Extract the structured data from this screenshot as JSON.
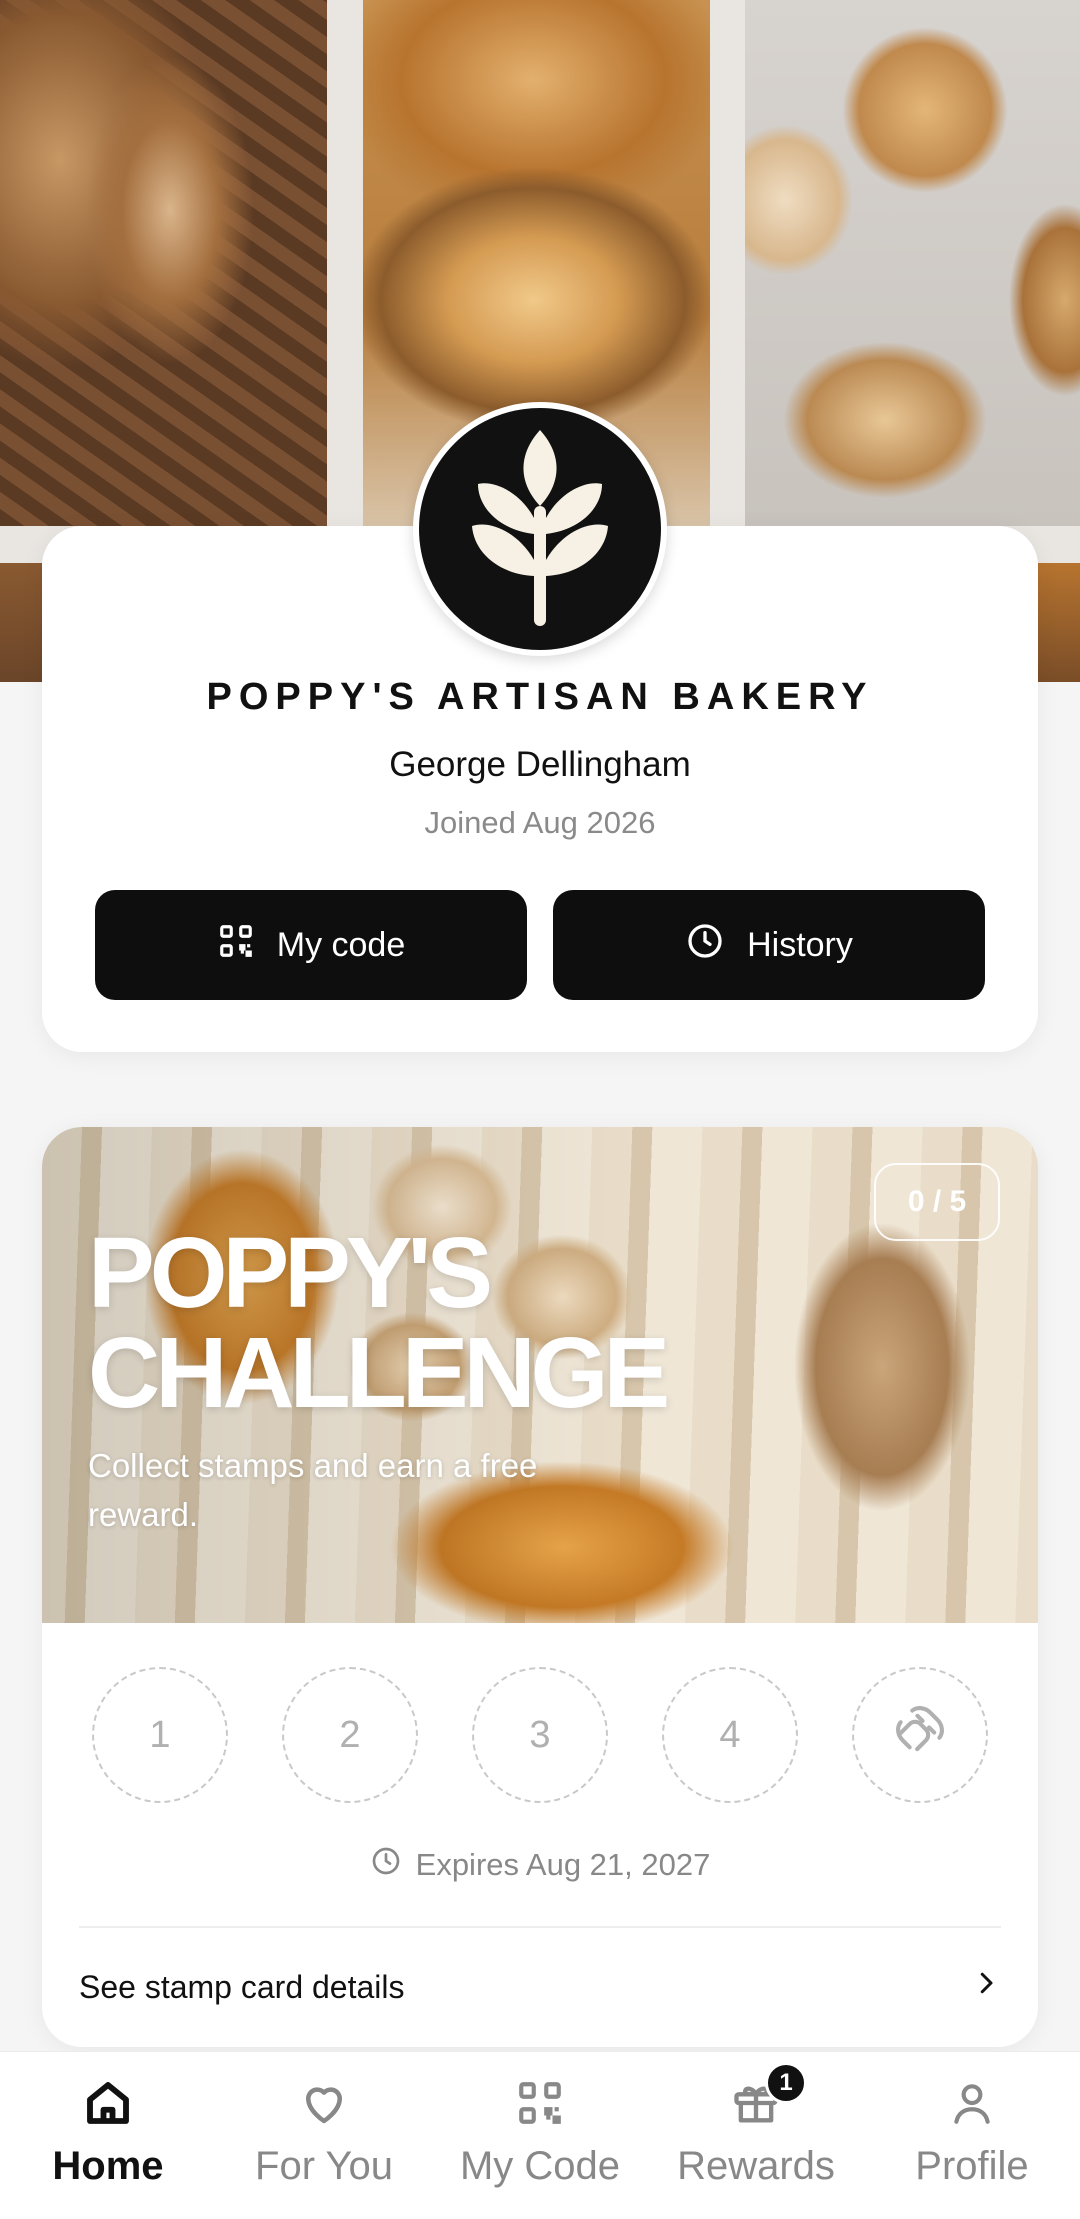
{
  "brand": {
    "name": "POPPY'S ARTISAN BAKERY",
    "logo_icon": "wheat-icon"
  },
  "member": {
    "name": "George Dellingham",
    "joined": "Joined Aug 2026"
  },
  "actions": {
    "my_code_label": "My code",
    "my_code_icon": "qr-code-icon",
    "history_label": "History",
    "history_icon": "clock-icon"
  },
  "challenge": {
    "counter": "0 / 5",
    "stamps_collected": 0,
    "stamps_total": 5,
    "title_line1": "POPPY'S",
    "title_line2": "CHALLENGE",
    "subtitle": "Collect stamps and earn a free reward.",
    "stamps": [
      "1",
      "2",
      "3",
      "4"
    ],
    "reward_icon": "croissant-icon",
    "expires": "Expires Aug 21, 2027",
    "details_label": "See stamp card details"
  },
  "nav": {
    "items": [
      {
        "label": "Home",
        "icon": "home-icon",
        "active": true
      },
      {
        "label": "For You",
        "icon": "heart-icon",
        "active": false
      },
      {
        "label": "My Code",
        "icon": "qr-code-icon",
        "active": false
      },
      {
        "label": "Rewards",
        "icon": "gift-icon",
        "active": false,
        "badge": "1"
      },
      {
        "label": "Profile",
        "icon": "person-icon",
        "active": false
      }
    ]
  },
  "colors": {
    "primary": "#0e0e0e",
    "background": "#f5f5f6",
    "muted_text": "#888888"
  }
}
